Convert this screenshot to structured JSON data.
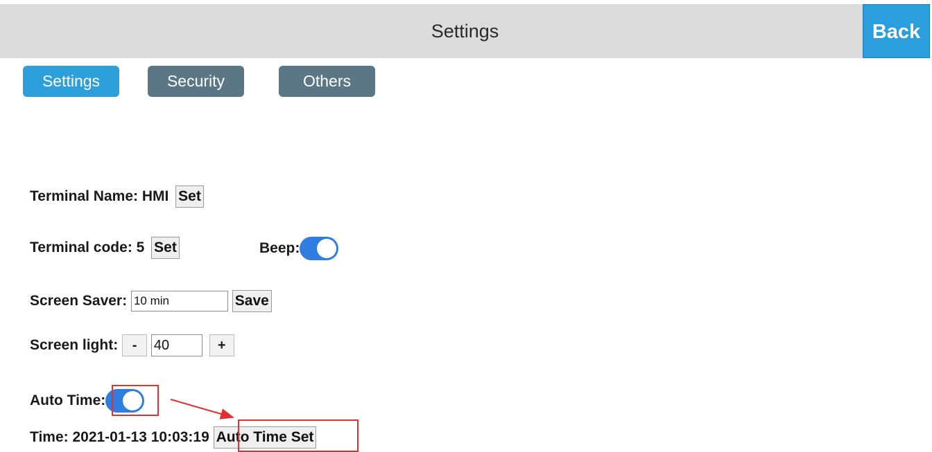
{
  "header": {
    "title": "Settings",
    "back_label": "Back"
  },
  "tabs": [
    {
      "label": "Settings",
      "active": true
    },
    {
      "label": "Security",
      "active": false
    },
    {
      "label": "Others",
      "active": false
    }
  ],
  "terminal_name": {
    "label": "Terminal Name: HMI",
    "button": "Set"
  },
  "terminal_code": {
    "label": "Terminal code: 5",
    "button": "Set"
  },
  "beep": {
    "label": "Beep:",
    "enabled": true
  },
  "screen_saver": {
    "label": "Screen Saver:",
    "value": "10 min",
    "button": "Save"
  },
  "screen_light": {
    "label": "Screen light:",
    "minus": "-",
    "value": "40",
    "plus": "+"
  },
  "auto_time": {
    "label": "Auto Time:",
    "enabled": true
  },
  "time": {
    "label": "Time: 2021-01-13 10:03:19",
    "button": "Auto Time Set"
  },
  "colors": {
    "accent": "#2d9fdb",
    "tab_inactive": "#5b7684",
    "toggle": "#2f7de1",
    "annotation": "#e03030"
  }
}
